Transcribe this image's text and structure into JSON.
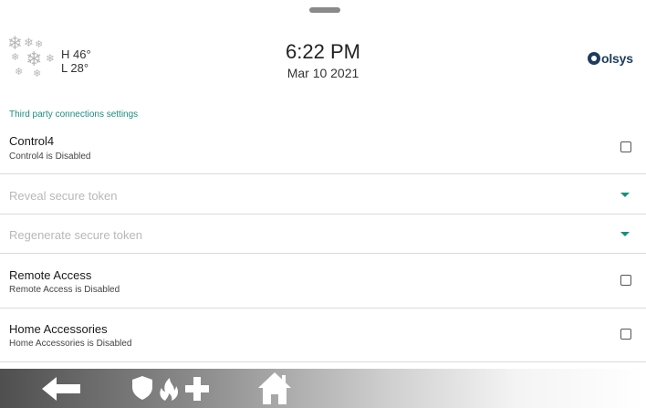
{
  "header": {
    "weather": {
      "icon": "snowflakes-icon",
      "high": "H 46°",
      "low": "L 28°"
    },
    "time": "6:22 PM",
    "date": "Mar 10 2021",
    "logo": "olsys"
  },
  "settings": {
    "section_title": "Third party connections settings",
    "control4": {
      "title": "Control4",
      "subtitle": "Control4 is Disabled",
      "checked": false
    },
    "reveal_token": {
      "label": "Reveal secure token"
    },
    "regenerate_token": {
      "label": "Regenerate secure token"
    },
    "remote_access": {
      "title": "Remote Access",
      "subtitle": "Remote Access is Disabled",
      "checked": false
    },
    "home_accessories": {
      "title": "Home Accessories",
      "subtitle": "Home Accessories is Disabled",
      "checked": false
    }
  },
  "bottom_nav": {
    "icons": [
      "back-arrow-icon",
      "police-shield-icon",
      "fire-flame-icon",
      "medical-cross-icon",
      "home-icon"
    ]
  },
  "colors": {
    "accent": "#1a8e7e",
    "muted_text": "#b8b8b8",
    "logo": "#1e3d5c"
  }
}
